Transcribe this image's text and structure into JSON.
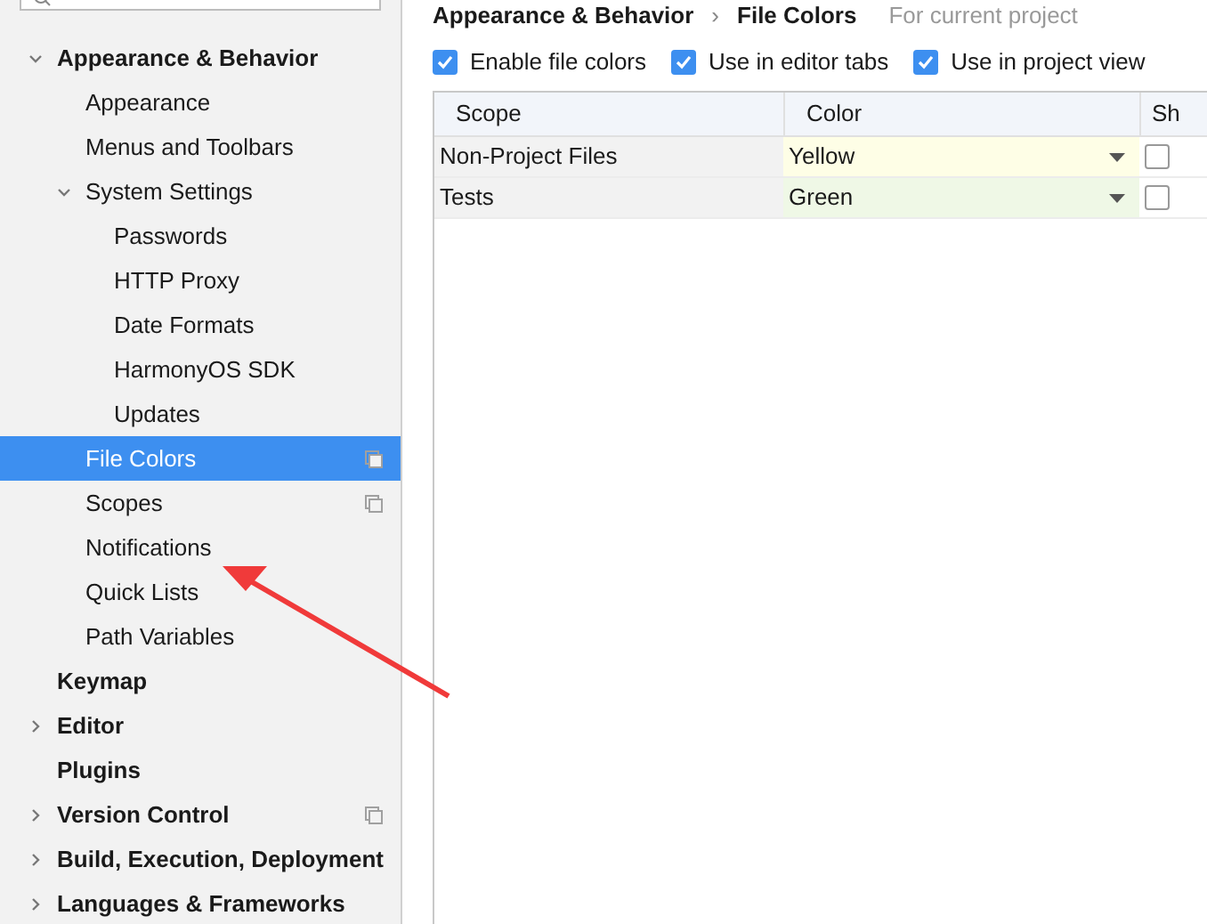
{
  "breadcrumb": {
    "path": "Appearance & Behavior",
    "separator": "›",
    "current": "File Colors",
    "scope_note": "For current project"
  },
  "sidebar": {
    "items": [
      {
        "label": "Appearance & Behavior",
        "bold": true,
        "expanded": true,
        "selected": false,
        "project_scoped": false,
        "children": [
          {
            "label": "Appearance",
            "selected": false,
            "project_scoped": false
          },
          {
            "label": "Menus and Toolbars",
            "selected": false,
            "project_scoped": false
          },
          {
            "label": "System Settings",
            "expanded": true,
            "selected": false,
            "project_scoped": false,
            "children": [
              {
                "label": "Passwords",
                "selected": false,
                "project_scoped": false
              },
              {
                "label": "HTTP Proxy",
                "selected": false,
                "project_scoped": false
              },
              {
                "label": "Date Formats",
                "selected": false,
                "project_scoped": false
              },
              {
                "label": "HarmonyOS SDK",
                "selected": false,
                "project_scoped": false
              },
              {
                "label": "Updates",
                "selected": false,
                "project_scoped": false
              }
            ]
          },
          {
            "label": "File Colors",
            "selected": true,
            "project_scoped": true
          },
          {
            "label": "Scopes",
            "selected": false,
            "project_scoped": true
          },
          {
            "label": "Notifications",
            "selected": false,
            "project_scoped": false
          },
          {
            "label": "Quick Lists",
            "selected": false,
            "project_scoped": false
          },
          {
            "label": "Path Variables",
            "selected": false,
            "project_scoped": false
          }
        ]
      },
      {
        "label": "Keymap",
        "bold": true,
        "selected": false,
        "project_scoped": false
      },
      {
        "label": "Editor",
        "bold": true,
        "expanded": false,
        "selected": false,
        "project_scoped": false
      },
      {
        "label": "Plugins",
        "bold": true,
        "selected": false,
        "project_scoped": false
      },
      {
        "label": "Version Control",
        "bold": true,
        "expanded": false,
        "selected": false,
        "project_scoped": true
      },
      {
        "label": "Build, Execution, Deployment",
        "bold": true,
        "expanded": false,
        "selected": false,
        "project_scoped": false
      },
      {
        "label": "Languages & Frameworks",
        "bold": true,
        "expanded": false,
        "selected": false,
        "project_scoped": false
      }
    ]
  },
  "options": [
    {
      "label": "Enable file colors",
      "checked": true
    },
    {
      "label": "Use in editor tabs",
      "checked": true
    },
    {
      "label": "Use in project view",
      "checked": true
    }
  ],
  "table": {
    "columns": [
      "Scope",
      "Color",
      "Sh"
    ],
    "rows": [
      {
        "scope": "Non-Project Files",
        "color_name": "Yellow",
        "color": "#fefee6",
        "checked": false
      },
      {
        "scope": "Tests",
        "color_name": "Green",
        "color": "#eff8e6",
        "checked": false
      }
    ]
  }
}
